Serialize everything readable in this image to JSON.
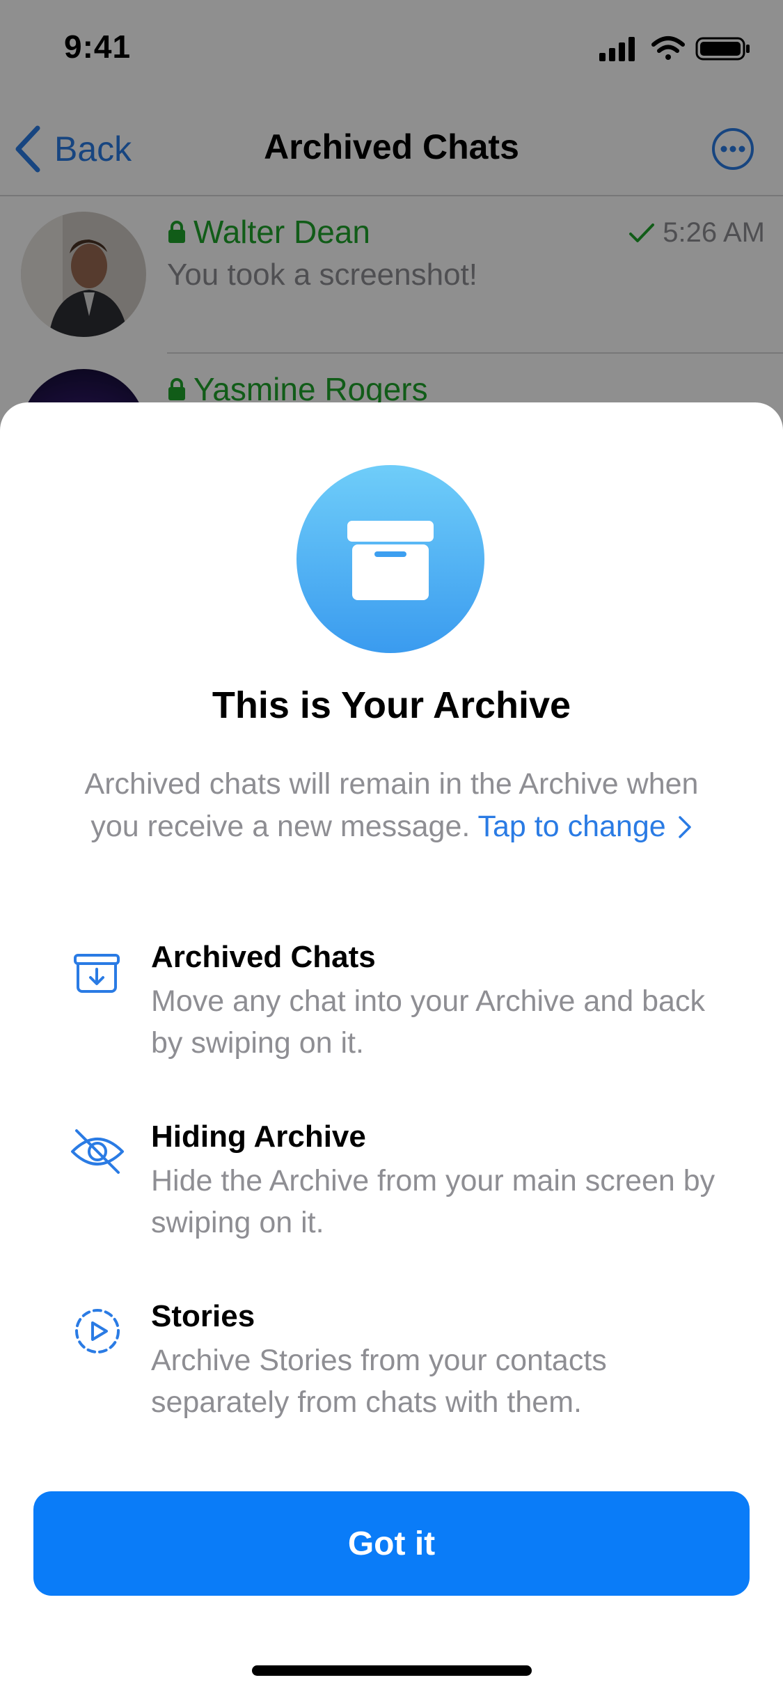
{
  "status_bar": {
    "time": "9:41"
  },
  "nav": {
    "back_label": "Back",
    "title": "Archived Chats",
    "more_icon": "ellipsis-circle-icon"
  },
  "chats": [
    {
      "name": "Walter Dean",
      "message": "You took a screenshot!",
      "time": "5:26 AM",
      "status_icon": "checkmark-icon",
      "lock_icon": "lock-icon"
    },
    {
      "name": "Yasmine Rogers",
      "lock_icon": "lock-icon"
    }
  ],
  "sheet": {
    "hero_icon": "archive-box-icon",
    "title": "This is Your Archive",
    "description": "Archived chats will remain in the Archive when you receive a new message.",
    "link_label": "Tap to change",
    "features": [
      {
        "icon": "archive-download-icon",
        "title": "Archived Chats",
        "description": "Move any chat into your Archive and back by swiping on it."
      },
      {
        "icon": "eye-slash-icon",
        "title": "Hiding Archive",
        "description": "Hide the Archive from your main screen by swiping on it."
      },
      {
        "icon": "stories-play-icon",
        "title": "Stories",
        "description": "Archive Stories from your contacts separately from chats with them."
      }
    ],
    "button_label": "Got it"
  },
  "colors": {
    "accent": "#0a7cf8",
    "link": "#2a7be4",
    "online_green": "#1fa42c",
    "secondary_text": "#8e8e93"
  }
}
